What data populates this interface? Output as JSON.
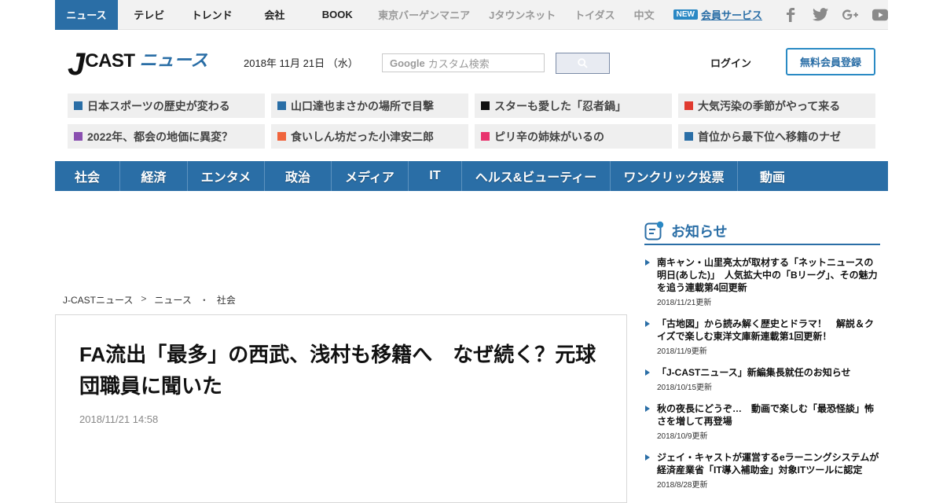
{
  "topnav": {
    "items": [
      "ニュース",
      "テレビ",
      "トレンド",
      "会社",
      "BOOK",
      "東京バーゲンマニア",
      "Jタウンネット",
      "トイダス",
      "中文"
    ],
    "new_badge": "NEW",
    "member_link": "会員サービス",
    "social_icons": [
      "facebook-icon",
      "twitter-icon",
      "google-plus-icon",
      "youtube-icon"
    ]
  },
  "header": {
    "logo_j": "J",
    "logo_cast": "CAST",
    "logo_news": "ニュース",
    "date": "2018年 11月 21日 （水）",
    "search_google": "Google",
    "search_placeholder": "カスタム検索",
    "login": "ログイン",
    "register": "無料会員登録"
  },
  "topics": [
    {
      "label": "日本スポーツの歴史が変わる",
      "color": "#2a6ea6"
    },
    {
      "label": "山口達也まさかの場所で目撃",
      "color": "#2a6ea6"
    },
    {
      "label": "スターも愛した「忍者鍋」",
      "color": "#111111"
    },
    {
      "label": "大気汚染の季節がやって来る",
      "color": "#e03a2f"
    },
    {
      "label": "2022年、都会の地価に異変？",
      "color": "#8a4fb0"
    },
    {
      "label": "食いしん坊だった小津安二郎",
      "color": "#f0643c"
    },
    {
      "label": "ピリ辛の姉妹がいるの",
      "color": "#e8336d"
    },
    {
      "label": "首位から最下位へ移籍のナゼ",
      "color": "#2a6ea6"
    }
  ],
  "categories": [
    "社会",
    "経済",
    "エンタメ",
    "政治",
    "メディア",
    "IT",
    "ヘルス&ビューティー",
    "ワンクリック投票",
    "動画"
  ],
  "breadcrumb": {
    "home": "J-CASTニュース",
    "sep1": ">",
    "section": "ニュース",
    "sep2": "・",
    "category": "社会"
  },
  "article": {
    "title": "FA流出「最多」の西武、浅村も移籍へ　なぜ続く？元球団職員に聞いた",
    "date": "2018/11/21 14:58"
  },
  "sidebar": {
    "title": "お知らせ",
    "items": [
      {
        "title": "南キャン・山里亮太が取材する「ネットニュースの明日(あした)」　人気拡大中の「Bリーグ」、その魅力を追う連載第4回更新",
        "date": "2018/11/21更新"
      },
      {
        "title": "「古地図」から読み解く歴史とドラマ！　解説＆クイズで楽しむ東洋文庫新連載第1回更新！",
        "date": "2018/11/9更新"
      },
      {
        "title": "「J-CASTニュース」新編集長就任のお知らせ",
        "date": "2018/10/15更新"
      },
      {
        "title": "秋の夜長にどうぞ…　動画で楽しむ「最恐怪談」怖さを増して再登場",
        "date": "2018/10/9更新"
      },
      {
        "title": "ジェイ・キャストが運営するeラーニングシステムが経済産業省「IT導入補助金」対象ITツールに認定",
        "date": "2018/8/28更新"
      }
    ]
  }
}
